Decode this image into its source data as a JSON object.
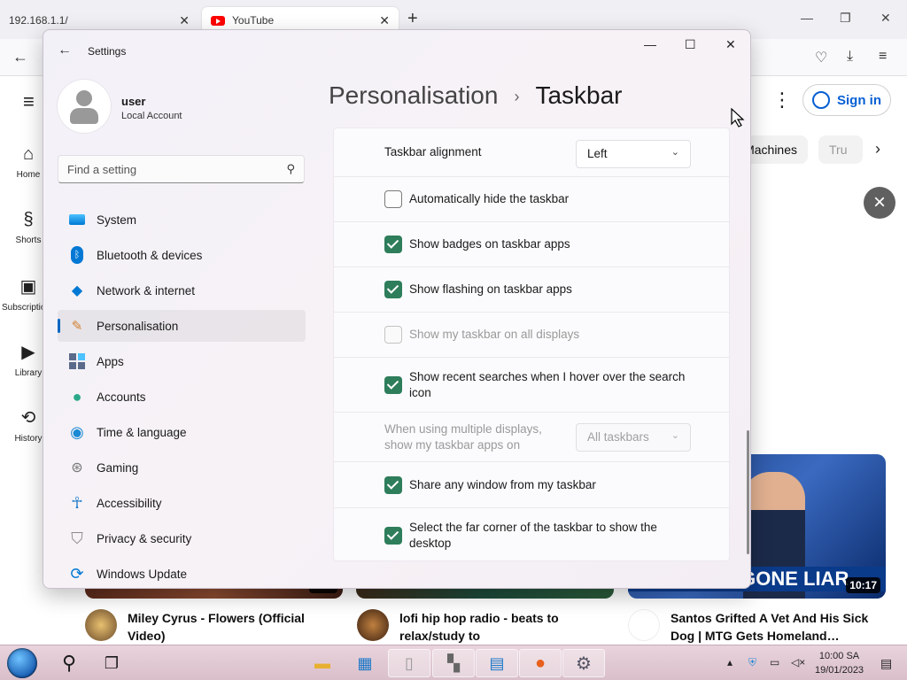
{
  "browser": {
    "tabs": [
      {
        "title": "192.168.1.1/"
      },
      {
        "title": "YouTube"
      }
    ],
    "close_glyph": "✕",
    "newtab_glyph": "+",
    "window_controls": [
      "—",
      "❐",
      "✕"
    ]
  },
  "youtube": {
    "sidebar": [
      {
        "label": "Home",
        "icon": "home-icon",
        "glyph": "⌂"
      },
      {
        "label": "Shorts",
        "icon": "shorts-icon",
        "glyph": "§"
      },
      {
        "label": "Subscriptions",
        "icon": "subscriptions-icon",
        "glyph": "▣"
      },
      {
        "label": "Library",
        "icon": "library-icon",
        "glyph": "▶"
      },
      {
        "label": "History",
        "icon": "history-icon",
        "glyph": "⟲"
      }
    ],
    "signin_label": "Sign in",
    "chips": [
      "Machines",
      "Tru"
    ],
    "videos": [
      {
        "title": "Miley Cyrus - Flowers (Official Video)",
        "duration": "3:22"
      },
      {
        "title": "lofi hip hop radio - beats to relax/study to"
      },
      {
        "title": "Santos Grifted A Vet And His Sick Dog | MTG Gets Homeland…",
        "duration": "10:17",
        "thumb_caption": "GGONE LIAR"
      }
    ]
  },
  "settings": {
    "app_title": "Settings",
    "user": {
      "name": "user",
      "account_type": "Local Account"
    },
    "search_placeholder": "Find a setting",
    "nav": [
      {
        "label": "System",
        "icon": "system-icon"
      },
      {
        "label": "Bluetooth & devices",
        "icon": "bluetooth-icon"
      },
      {
        "label": "Network & internet",
        "icon": "wifi-icon"
      },
      {
        "label": "Personalisation",
        "icon": "brush-icon",
        "active": true
      },
      {
        "label": "Apps",
        "icon": "apps-icon"
      },
      {
        "label": "Accounts",
        "icon": "accounts-icon"
      },
      {
        "label": "Time & language",
        "icon": "globe-icon"
      },
      {
        "label": "Gaming",
        "icon": "gamepad-icon"
      },
      {
        "label": "Accessibility",
        "icon": "accessibility-icon"
      },
      {
        "label": "Privacy & security",
        "icon": "shield-icon"
      },
      {
        "label": "Windows Update",
        "icon": "update-icon"
      }
    ],
    "breadcrumb": {
      "parent": "Personalisation",
      "separator": "›",
      "current": "Taskbar"
    },
    "taskbar_behaviours": {
      "alignment": {
        "label": "Taskbar alignment",
        "value": "Left"
      },
      "options": [
        {
          "label": "Automatically hide the taskbar",
          "state": "unchecked"
        },
        {
          "label": "Show badges on taskbar apps",
          "state": "checked"
        },
        {
          "label": "Show flashing on taskbar apps",
          "state": "checked"
        },
        {
          "label": "Show my taskbar on all displays",
          "state": "disabled"
        },
        {
          "label": "Show recent searches when I hover over the search icon",
          "state": "checked"
        }
      ],
      "multi_display": {
        "label": "When using multiple displays, show my taskbar apps on",
        "value": "All taskbars",
        "disabled": true
      },
      "options_after": [
        {
          "label": "Share any window from my taskbar",
          "state": "checked"
        },
        {
          "label": "Select the far corner of the taskbar to show the desktop",
          "state": "checked"
        }
      ]
    }
  },
  "os_taskbar": {
    "clock_time": "10:00 SA",
    "clock_date": "19/01/2023"
  }
}
